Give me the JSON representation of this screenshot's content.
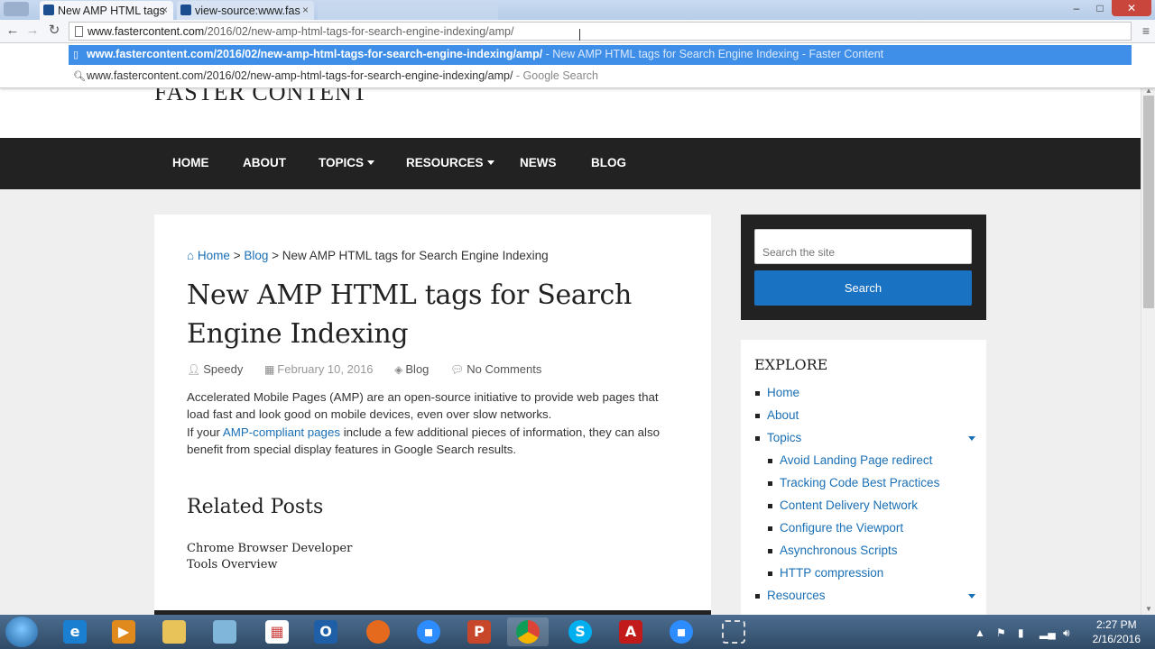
{
  "browser": {
    "tabs": [
      {
        "label": "New AMP HTML tags",
        "close": "×"
      },
      {
        "label": "view-source:www.fas",
        "close": "×"
      }
    ],
    "window_buttons": {
      "minimize": "–",
      "maximize": "□",
      "close": "✕"
    },
    "address": {
      "host": "www.fastercontent.com",
      "path": "/2016/02/new-amp-html-tags-for-search-engine-indexing/amp/"
    },
    "suggestions": [
      {
        "url": "www.fastercontent.com/2016/02/new-amp-html-tags-for-search-engine-indexing/amp/",
        "desc": " - New AMP HTML tags for Search Engine Indexing - Faster Content"
      },
      {
        "url": "www.fastercontent.com/2016/02/new-amp-html-tags-for-search-engine-indexing/amp/",
        "desc": " - Google Search"
      }
    ]
  },
  "site": {
    "title": "FASTER CONTENT",
    "nav": [
      "HOME",
      "ABOUT",
      "TOPICS",
      "RESOURCES",
      "NEWS",
      "BLOG"
    ]
  },
  "article": {
    "breadcrumb": {
      "home": "Home",
      "sep1": " > ",
      "blog": "Blog",
      "sep2": " > ",
      "current": "New AMP HTML tags for Search Engine Indexing"
    },
    "title": "New AMP HTML tags for Search Engine Indexing",
    "author": "Speedy",
    "date": "February 10, 2016",
    "category": "Blog",
    "comments": "No Comments",
    "para1": "Accelerated Mobile Pages (AMP) are an open-source initiative to provide web pages that load fast and look good on mobile devices, even over slow networks.",
    "para2_pre": "If your ",
    "para2_link": "AMP-compliant pages",
    "para2_post": " include a few additional pieces of information, they can also benefit from special display features in Google Search results.",
    "related_heading": "Related Posts",
    "related_post": "Chrome Browser Developer Tools Overview"
  },
  "sidebar": {
    "search_placeholder": "Search the site",
    "search_button": "Search",
    "explore_heading": "EXPLORE",
    "items": [
      {
        "label": "Home",
        "level": 0
      },
      {
        "label": "About",
        "level": 0
      },
      {
        "label": "Topics",
        "level": 0
      },
      {
        "label": "Avoid Landing Page redirect",
        "level": 1
      },
      {
        "label": "Tracking Code Best Practices",
        "level": 1
      },
      {
        "label": "Content Delivery Network",
        "level": 1
      },
      {
        "label": "Configure the Viewport",
        "level": 1
      },
      {
        "label": "Asynchronous Scripts",
        "level": 1
      },
      {
        "label": "HTTP compression",
        "level": 1
      },
      {
        "label": "Resources",
        "level": 0
      }
    ]
  },
  "taskbar": {
    "time": "2:27 PM",
    "date": "2/16/2016"
  },
  "colors": {
    "link": "#1a6fb5",
    "nav_bg": "#222222",
    "search_button": "#1a72c2",
    "suggestion_highlight": "#3f8fe8"
  }
}
